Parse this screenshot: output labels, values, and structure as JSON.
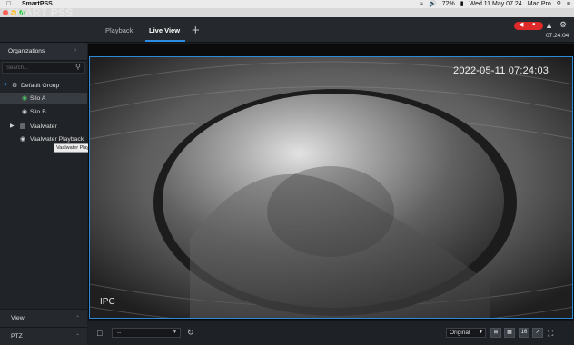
{
  "menubar": {
    "app_name": "SmartPSS",
    "battery": "72%",
    "datetime": "Wed 11 May  07 24",
    "computer_name": "Mac Pro"
  },
  "header": {
    "brand_light": "SMART ",
    "brand_bold": "PSS",
    "tabs": [
      {
        "label": "Playback"
      },
      {
        "label": "Live View",
        "active": true
      }
    ],
    "add_tab_glyph": "+",
    "clock": "07:24:04",
    "alarm_color": "#e02a2a",
    "accent_color": "#2e8de3"
  },
  "sidebar": {
    "organizations_label": "Organizations",
    "search_placeholder": "Search...",
    "tree": [
      {
        "label": "Default Group",
        "icon": "group-icon",
        "expanded": true
      },
      {
        "label": "Silo A",
        "icon": "camera-pin-icon",
        "selected": true
      },
      {
        "label": "Silo B",
        "icon": "camera-pin-icon"
      },
      {
        "label": "Vaalwater",
        "icon": "nvr-device-icon",
        "collapsed": true
      },
      {
        "label": "Vaalwater Playback",
        "icon": "camera-pin-icon"
      }
    ],
    "tooltip": "Vaalwater Playback",
    "bottom_sections": [
      {
        "label": "View"
      },
      {
        "label": "PTZ"
      }
    ]
  },
  "video": {
    "osd_timestamp": "2022-05-11 07:24:03",
    "channel_name": "IPC"
  },
  "toolbar": {
    "screen_select_value": "--",
    "ratio_select_value": "Original",
    "layout_1x1": "",
    "layout_2x2": "",
    "layout_16": "16"
  }
}
